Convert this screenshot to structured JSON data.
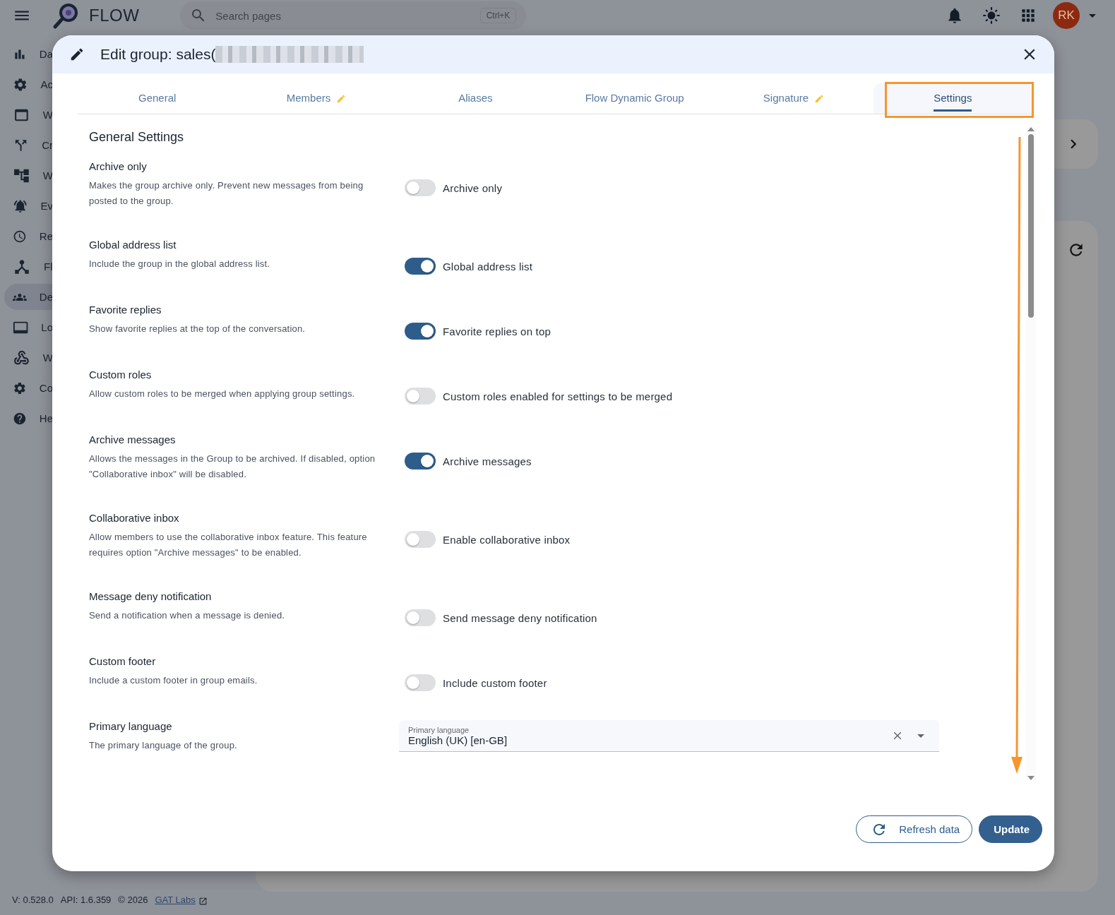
{
  "topbar": {
    "brand": "FLOW",
    "search": {
      "placeholder": "Search pages",
      "shortcut": "Ctrl+K"
    },
    "avatar": "RK"
  },
  "sidebar": {
    "items": [
      {
        "label": "Da",
        "selected": false
      },
      {
        "label": "Ac",
        "selected": false
      },
      {
        "label": "W",
        "selected": false
      },
      {
        "label": "Cr",
        "selected": false
      },
      {
        "label": "W",
        "selected": false
      },
      {
        "label": "Ev",
        "selected": false
      },
      {
        "label": "Re",
        "selected": false
      },
      {
        "label": "Fl",
        "selected": false
      },
      {
        "label": "De",
        "selected": true
      },
      {
        "label": "Lo",
        "selected": false
      },
      {
        "label": "W",
        "selected": false
      },
      {
        "label": "Co",
        "selected": false
      },
      {
        "label": "He",
        "selected": false
      }
    ]
  },
  "footer": {
    "version": "V: 0.528.0",
    "api": "API: 1.6.359",
    "copyright": "© 2026",
    "link": "GAT Labs"
  },
  "dialog": {
    "title": "Edit group: sales(",
    "tabs": [
      {
        "label": "General",
        "selected": false,
        "edited": false
      },
      {
        "label": "Members",
        "selected": false,
        "edited": true
      },
      {
        "label": "Aliases",
        "selected": false,
        "edited": false
      },
      {
        "label": "Flow Dynamic Group",
        "selected": false,
        "edited": false
      },
      {
        "label": "Signature",
        "selected": false,
        "edited": true
      },
      {
        "label": "Settings",
        "selected": true,
        "edited": false
      }
    ],
    "section_title": "General Settings",
    "settings": [
      {
        "kind": "toggle",
        "title": "Archive only",
        "description": "Makes the group archive only. Prevent new messages from being posted to the group.",
        "label": "Archive only",
        "on": false
      },
      {
        "kind": "toggle",
        "title": "Global address list",
        "description": "Include the group in the global address list.",
        "label": "Global address list",
        "on": true
      },
      {
        "kind": "toggle",
        "title": "Favorite replies",
        "description": "Show favorite replies at the top of the conversation.",
        "label": "Favorite replies on top",
        "on": true
      },
      {
        "kind": "toggle",
        "title": "Custom roles",
        "description": "Allow custom roles to be merged when applying group settings.",
        "label": "Custom roles enabled for settings to be merged",
        "on": false
      },
      {
        "kind": "toggle",
        "title": "Archive messages",
        "description": "Allows the messages in the Group to be archived. If disabled, option \"Collaborative inbox\" will be disabled.",
        "label": "Archive messages",
        "on": true
      },
      {
        "kind": "toggle",
        "title": "Collaborative inbox",
        "description": "Allow members to use the collaborative inbox feature. This feature requires option \"Archive messages\" to be enabled.",
        "label": "Enable collaborative inbox",
        "on": false
      },
      {
        "kind": "toggle",
        "title": "Message deny notification",
        "description": "Send a notification when a message is denied.",
        "label": "Send message deny notification",
        "on": false
      },
      {
        "kind": "toggle",
        "title": "Custom footer",
        "description": "Include a custom footer in group emails.",
        "label": "Include custom footer",
        "on": false
      },
      {
        "kind": "select",
        "title": "Primary language",
        "description": "The primary language of the group.",
        "label": "Primary language",
        "value": "English (UK) [en-GB]"
      }
    ],
    "buttons": [
      {
        "kind": "outlined",
        "label": "Refresh data"
      },
      {
        "kind": "filled",
        "label": "Update"
      }
    ]
  }
}
